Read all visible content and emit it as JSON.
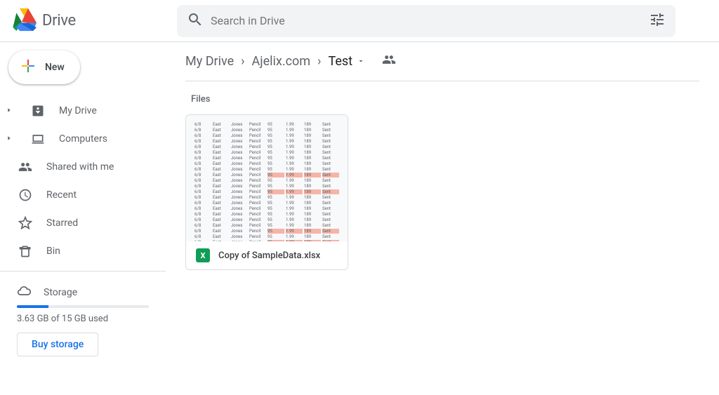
{
  "app": {
    "name": "Drive"
  },
  "search": {
    "placeholder": "Search in Drive"
  },
  "new_button": {
    "label": "New"
  },
  "nav": {
    "my_drive": "My Drive",
    "computers": "Computers",
    "shared": "Shared with me",
    "recent": "Recent",
    "starred": "Starred",
    "bin": "Bin",
    "storage": "Storage"
  },
  "storage": {
    "used_text": "3.63 GB of 15 GB used",
    "percent": 24,
    "buy_label": "Buy storage"
  },
  "breadcrumb": {
    "items": [
      {
        "label": "My Drive"
      },
      {
        "label": "Ajelix.com"
      },
      {
        "label": "Test",
        "current": true
      }
    ]
  },
  "section_label": "Files",
  "files": [
    {
      "name": "Copy of SampleData.xlsx",
      "type": "xlsx"
    }
  ]
}
